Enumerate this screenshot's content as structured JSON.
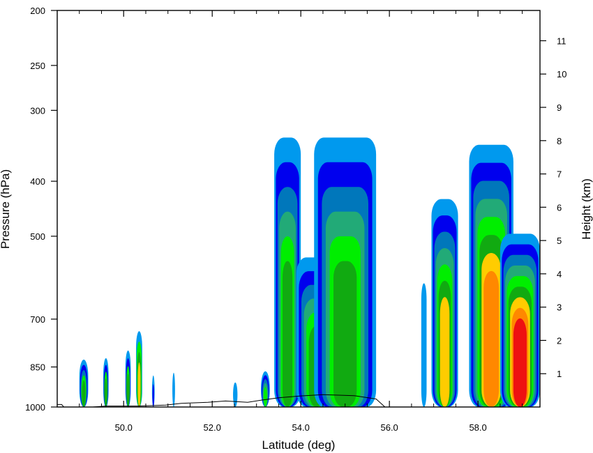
{
  "chart_data": {
    "type": "heatmap",
    "title": "",
    "xlabel": "Latitude (deg)",
    "ylabel": "Pressure (hPa)",
    "y2label": "Height (km)",
    "xlim": [
      48.5,
      59.4
    ],
    "ylim": [
      1000,
      200
    ],
    "yscale": "log",
    "x_ticks": [
      {
        "value": 50,
        "label": "50.0"
      },
      {
        "value": 52,
        "label": "52.0"
      },
      {
        "value": 54,
        "label": "54.0"
      },
      {
        "value": 56,
        "label": "56.0"
      },
      {
        "value": 58,
        "label": "58.0"
      }
    ],
    "y_ticks": [
      {
        "value": 1000,
        "label": "1000"
      },
      {
        "value": 850,
        "label": "850"
      },
      {
        "value": 700,
        "label": "700"
      },
      {
        "value": 500,
        "label": "500"
      },
      {
        "value": 400,
        "label": "400"
      },
      {
        "value": 300,
        "label": "300"
      },
      {
        "value": 250,
        "label": "250"
      },
      {
        "value": 200,
        "label": "200"
      }
    ],
    "y2_ticks": [
      {
        "value": 1,
        "label": "1"
      },
      {
        "value": 2,
        "label": "2"
      },
      {
        "value": 3,
        "label": "3"
      },
      {
        "value": 4,
        "label": "4"
      },
      {
        "value": 5,
        "label": "5"
      },
      {
        "value": 6,
        "label": "6"
      },
      {
        "value": 7,
        "label": "7"
      },
      {
        "value": 8,
        "label": "8"
      },
      {
        "value": 9,
        "label": "9"
      },
      {
        "value": 10,
        "label": "10"
      },
      {
        "value": 11,
        "label": "11"
      }
    ],
    "grid": false,
    "legend": "none",
    "colors": [
      "#0099ee",
      "#0000ee",
      "#0077bb",
      "#22aa77",
      "#00ee00",
      "#11aa11",
      "#ffcc00",
      "#ff8800",
      "#ee1111"
    ],
    "columns": [
      {
        "lat": 49.1,
        "width": 0.2,
        "top_p": 825,
        "levels": [
          0,
          1,
          2,
          4,
          5
        ]
      },
      {
        "lat": 49.6,
        "width": 0.12,
        "top_p": 820,
        "levels": [
          0,
          1,
          4,
          5
        ]
      },
      {
        "lat": 50.1,
        "width": 0.12,
        "top_p": 795,
        "levels": [
          0,
          1,
          4,
          5
        ]
      },
      {
        "lat": 50.35,
        "width": 0.14,
        "top_p": 735,
        "levels": [
          0,
          4,
          5,
          6
        ]
      },
      {
        "lat": 50.67,
        "width": 0.06,
        "top_p": 880,
        "levels": [
          0,
          1
        ]
      },
      {
        "lat": 51.13,
        "width": 0.06,
        "top_p": 870,
        "levels": [
          0
        ]
      },
      {
        "lat": 52.52,
        "width": 0.1,
        "top_p": 905,
        "levels": [
          0
        ]
      },
      {
        "lat": 53.2,
        "width": 0.2,
        "top_p": 865,
        "levels": [
          0,
          1,
          2,
          3,
          4
        ]
      },
      {
        "lat": 53.7,
        "width": 0.6,
        "top_p": 335,
        "levels": [
          0,
          1,
          2,
          3,
          4,
          5
        ]
      },
      {
        "lat": 54.35,
        "width": 0.9,
        "top_p": 545,
        "levels": [
          0,
          1,
          2,
          3,
          4,
          5
        ]
      },
      {
        "lat": 55.0,
        "width": 1.4,
        "top_p": 335,
        "levels": [
          0,
          1,
          2,
          3,
          4,
          5
        ]
      },
      {
        "lat": 56.78,
        "width": 0.12,
        "top_p": 605,
        "levels": [
          0
        ]
      },
      {
        "lat": 57.25,
        "width": 0.6,
        "top_p": 430,
        "levels": [
          0,
          1,
          2,
          3,
          4,
          5,
          6
        ]
      },
      {
        "lat": 58.3,
        "width": 1.0,
        "top_p": 345,
        "levels": [
          0,
          1,
          2,
          3,
          4,
          5,
          6,
          7
        ]
      },
      {
        "lat": 58.95,
        "width": 0.9,
        "top_p": 495,
        "levels": [
          0,
          1,
          2,
          3,
          4,
          5,
          6,
          7,
          8
        ]
      }
    ],
    "terrain": [
      [
        48.5,
        990
      ],
      [
        48.6,
        990
      ],
      [
        48.65,
        1000
      ],
      [
        49.1,
        1000
      ],
      [
        49.3,
        1000
      ],
      [
        49.6,
        996
      ],
      [
        50.3,
        996
      ],
      [
        50.95,
        992
      ],
      [
        51.3,
        985
      ],
      [
        51.9,
        981
      ],
      [
        52.3,
        976
      ],
      [
        52.8,
        981
      ],
      [
        53.1,
        973
      ],
      [
        53.5,
        963
      ],
      [
        54.0,
        956
      ],
      [
        54.5,
        951
      ],
      [
        55.2,
        955
      ],
      [
        55.7,
        968
      ],
      [
        55.9,
        1000
      ],
      [
        59.4,
        1000
      ]
    ]
  }
}
